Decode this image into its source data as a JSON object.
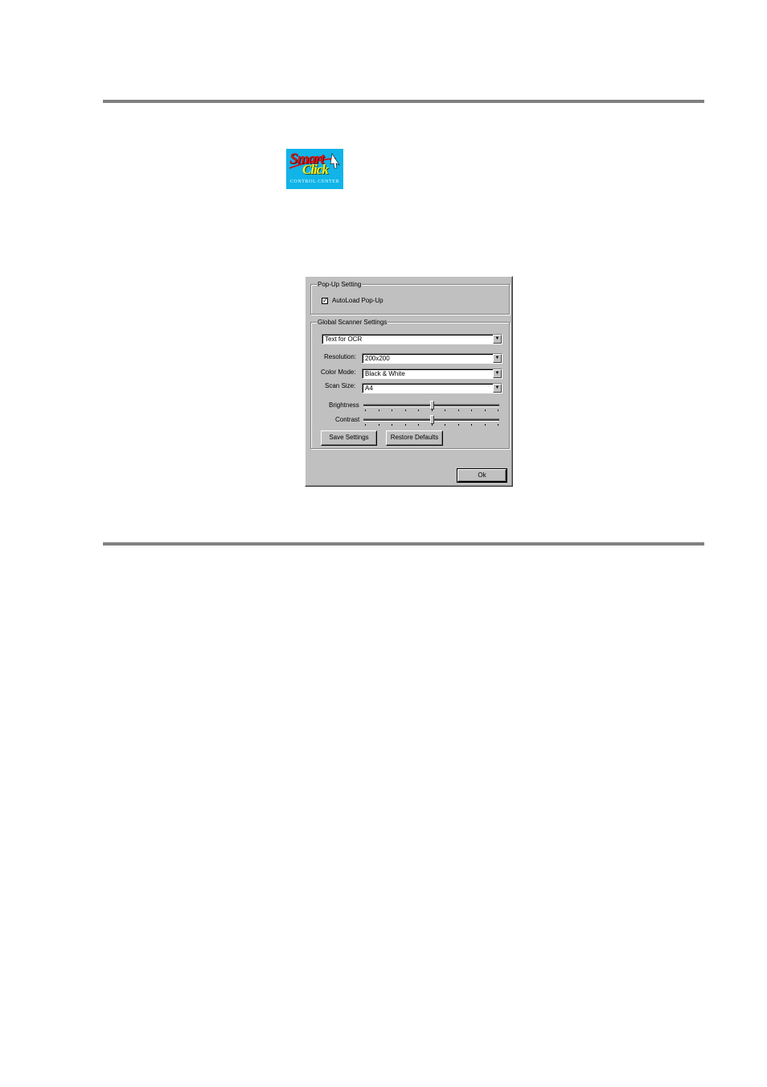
{
  "logo": {
    "word_1": "Smart",
    "word_2": "Click",
    "tagline": "CONTROL CENTER"
  },
  "dialog": {
    "popup_group": {
      "title": "Pop-Up Setting",
      "autoload_label": "AutoLoad Pop-Up",
      "autoload_checked": true
    },
    "global_group": {
      "title": "Global Scanner Settings",
      "mode_value": "Text for OCR",
      "resolution_label": "Resolution:",
      "resolution_value": "200x200",
      "color_mode_label": "Color Mode:",
      "color_mode_value": "Black & White",
      "scan_size_label": "Scan Size:",
      "scan_size_value": "A4",
      "brightness_label": "Brightness",
      "brightness_level": 0.5,
      "contrast_label": "Contrast",
      "contrast_level": 0.5,
      "save_label": "Save Settings",
      "restore_label": "Restore Defaults"
    },
    "ok_label": "Ok"
  },
  "colors": {
    "logo_bg": "#10b4e8",
    "dialog_face": "#c0c0c0",
    "rule": "#808080"
  }
}
